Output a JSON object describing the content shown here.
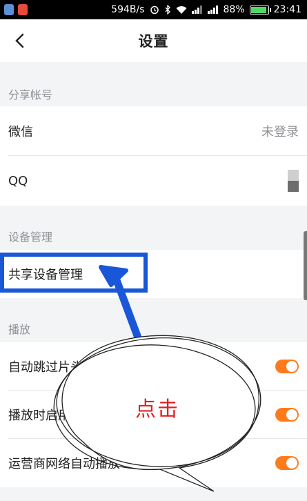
{
  "status_bar": {
    "network_speed": "594B/s",
    "battery_percent": "88%",
    "time": "23:41",
    "colors": {
      "background": "#000000",
      "battery_fill": "#4cd964"
    }
  },
  "header": {
    "back_icon": "chevron-left-icon",
    "title": "设置"
  },
  "sections": {
    "share_accounts": {
      "title": "分享帐号",
      "wechat": {
        "label": "微信",
        "status": "未登录"
      },
      "qq": {
        "label": "QQ"
      }
    },
    "device_management": {
      "title": "设备管理",
      "shared_devices": {
        "label": "共享设备管理"
      }
    },
    "playback": {
      "title": "播放",
      "items": [
        {
          "label": "自动跳过片头片尾",
          "toggle_on": true
        },
        {
          "label": "播放时启用硬件加速",
          "toggle_on": true
        },
        {
          "label": "运营商网络自动播放",
          "toggle_on": true
        }
      ]
    }
  },
  "annotation": {
    "callout_text": "点击",
    "colors": {
      "arrow": "#1a56d8",
      "text": "#e12020"
    }
  },
  "colors": {
    "accent": "#ff7a1a",
    "background": "#f3f4f6",
    "secondary_text": "#8d8f94"
  }
}
